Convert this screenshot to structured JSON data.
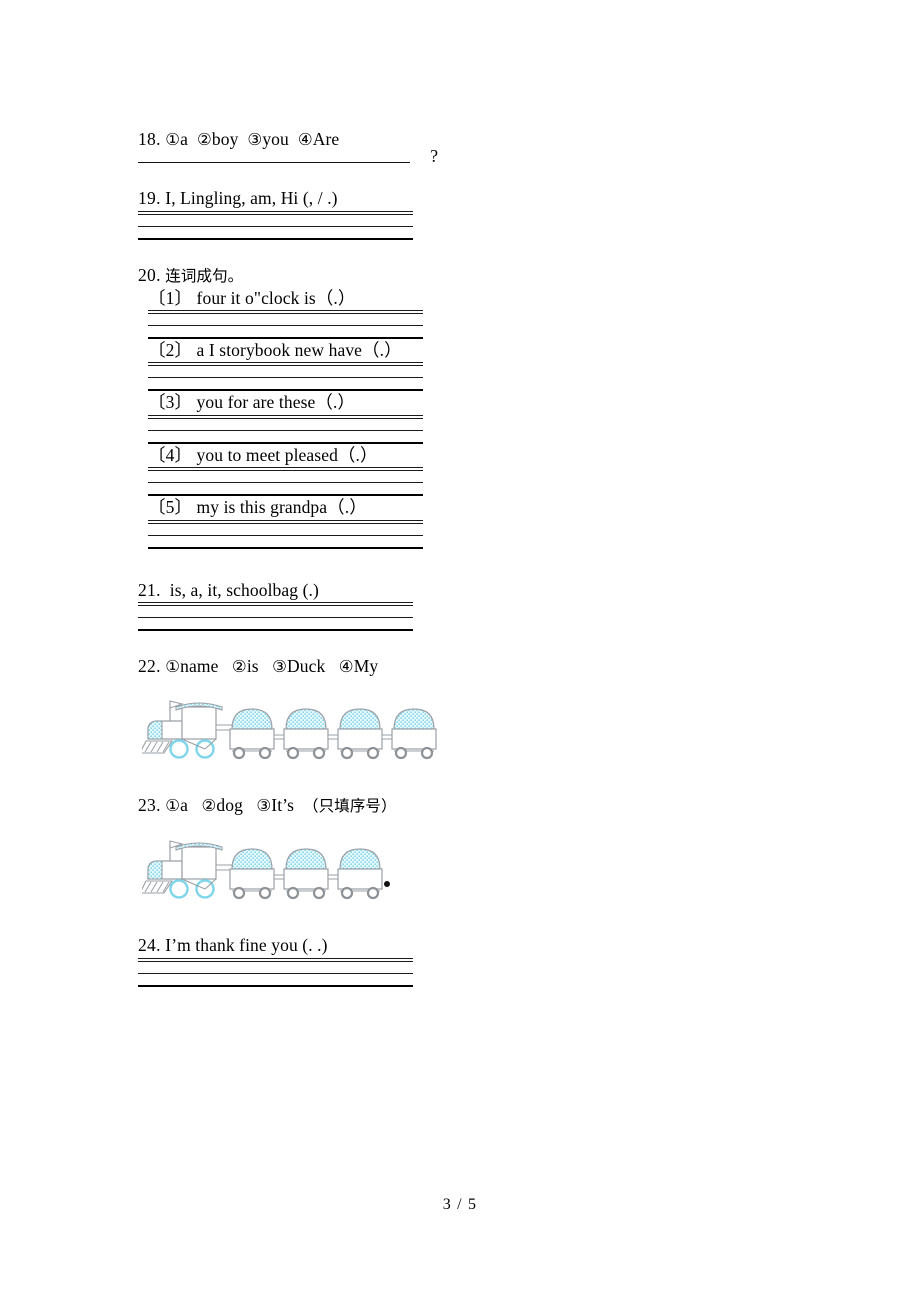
{
  "document": {
    "page_footer": "3 / 5"
  },
  "questions": [
    {
      "id": "q18",
      "number": "18.",
      "choices": [
        {
          "marker": "①",
          "word": "a"
        },
        {
          "marker": "②",
          "word": "boy"
        },
        {
          "marker": "③",
          "word": "you"
        },
        {
          "marker": "④",
          "word": "Are"
        }
      ],
      "answer_punctuation": "?"
    },
    {
      "id": "q19",
      "number": "19.",
      "prompt": "I, Lingling, am, Hi (, / .)"
    },
    {
      "id": "q20",
      "number": "20.",
      "prompt": "连词成句。",
      "items": [
        {
          "label": "〔1〕",
          "text": "four it o\"clock is（.）"
        },
        {
          "label": "〔2〕",
          "text": "a I storybook new have（.）"
        },
        {
          "label": "〔3〕",
          "text": "you for are these（.）"
        },
        {
          "label": "〔4〕",
          "text": "you to meet pleased（.）"
        },
        {
          "label": "〔5〕",
          "text": "my is this grandpa（.）"
        }
      ]
    },
    {
      "id": "q21",
      "number": "21.",
      "prompt": "is, a, it, schoolbag (.)"
    },
    {
      "id": "q22",
      "number": "22.",
      "choices": [
        {
          "marker": "①",
          "word": "name"
        },
        {
          "marker": "②",
          "word": "is"
        },
        {
          "marker": "③",
          "word": "Duck"
        },
        {
          "marker": "④",
          "word": "My"
        }
      ],
      "figure": {
        "name": "train-illustration",
        "cars": 4,
        "trailing_dot": false
      }
    },
    {
      "id": "q23",
      "number": "23.",
      "choices": [
        {
          "marker": "①",
          "word": "a"
        },
        {
          "marker": "②",
          "word": "dog"
        },
        {
          "marker": "③",
          "word": "It’s"
        }
      ],
      "note": "（只填序号）",
      "figure": {
        "name": "train-illustration",
        "cars": 3,
        "trailing_dot": true
      }
    },
    {
      "id": "q24",
      "number": "24.",
      "prompt": "I’m  thank  fine  you (. .)"
    }
  ],
  "colors": {
    "ink": "#000000",
    "rule": "#1a1a1a",
    "train_dome": "#b9e9f5",
    "train_outline": "#9aa0a6",
    "train_wheel": "#8d9296",
    "train_accent": "#7fd6ea"
  }
}
